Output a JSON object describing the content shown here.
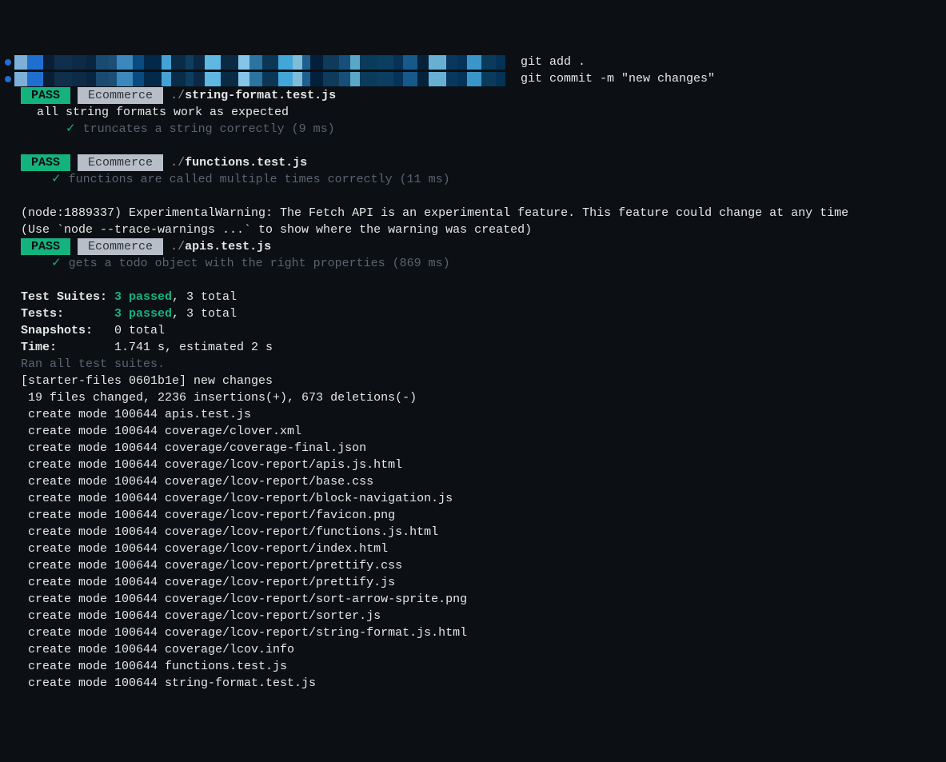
{
  "prompts": [
    {
      "cmd": "git add ."
    },
    {
      "cmd": "git commit -m \"new changes\""
    }
  ],
  "prompt_bar_colors": [
    "#7db0d8",
    "#1f6fd0",
    "#0a1f33",
    "#0f2f4d",
    "#0d2a46",
    "#0a2540",
    "#1a4a70",
    "#1c4f78",
    "#3a88bc",
    "#094b80",
    "#03294a",
    "#44a2d6",
    "#0a2c47",
    "#0e3e5f",
    "#0b2945",
    "#5fb8e2",
    "#0a2a44",
    "#86c4e8",
    "#2b73a0",
    "#0b3656",
    "#42a6d9",
    "#7fbcd8",
    "#1d608e",
    "#02203c",
    "#0f3a5a",
    "#164f7a",
    "#5aa7c9",
    "#0a3b5a",
    "#0b3e60",
    "#063255",
    "#16598a",
    "#05223a",
    "#67b0d4",
    "#09385e",
    "#033357",
    "#3a96c8",
    "#0a3b5a",
    "#033357"
  ],
  "prompt_bar_widths": [
    16,
    20,
    14,
    22,
    18,
    12,
    16,
    10,
    20,
    14,
    22,
    12,
    18,
    10,
    14,
    20,
    22,
    14,
    16,
    20,
    18,
    12,
    10,
    16,
    20,
    14,
    12,
    22,
    20,
    12,
    18,
    14,
    22,
    14,
    12,
    18,
    18,
    12
  ],
  "test_blocks": [
    {
      "status": "PASS",
      "tag": "Ecommerce",
      "path_prefix": "./",
      "file": "string-format.test.js",
      "describe": "all string formats work as expected",
      "tests": [
        {
          "name": "truncates a string correctly",
          "time": "(9 ms)"
        }
      ]
    },
    {
      "status": "PASS",
      "tag": "Ecommerce",
      "path_prefix": "./",
      "file": "functions.test.js",
      "describe": null,
      "tests": [
        {
          "name": "functions are called multiple times correctly",
          "time": "(11 ms)"
        }
      ]
    }
  ],
  "warning_lines": [
    "(node:1889337) ExperimentalWarning: The Fetch API is an experimental feature. This feature could change at any time",
    "(Use `node --trace-warnings ...` to show where the warning was created)"
  ],
  "test_block_after_warning": {
    "status": "PASS",
    "tag": "Ecommerce",
    "path_prefix": "./",
    "file": "apis.test.js",
    "describe": null,
    "tests": [
      {
        "name": "gets a todo object with the right properties",
        "time": "(869 ms)"
      }
    ]
  },
  "summary": {
    "suites_label": "Test Suites:",
    "suites_passed": "3 passed",
    "suites_total": ", 3 total",
    "tests_label": "Tests:",
    "tests_passed": "3 passed",
    "tests_total": ", 3 total",
    "snapshots_label": "Snapshots:",
    "snapshots_value": "0 total",
    "time_label": "Time:",
    "time_value": "1.741 s, estimated 2 s",
    "ran_all": "Ran all test suites."
  },
  "commit": {
    "header": "[starter-files 0601b1e] new changes",
    "stats": " 19 files changed, 2236 insertions(+), 673 deletions(-)",
    "created": [
      " create mode 100644 apis.test.js",
      " create mode 100644 coverage/clover.xml",
      " create mode 100644 coverage/coverage-final.json",
      " create mode 100644 coverage/lcov-report/apis.js.html",
      " create mode 100644 coverage/lcov-report/base.css",
      " create mode 100644 coverage/lcov-report/block-navigation.js",
      " create mode 100644 coverage/lcov-report/favicon.png",
      " create mode 100644 coverage/lcov-report/functions.js.html",
      " create mode 100644 coverage/lcov-report/index.html",
      " create mode 100644 coverage/lcov-report/prettify.css",
      " create mode 100644 coverage/lcov-report/prettify.js",
      " create mode 100644 coverage/lcov-report/sort-arrow-sprite.png",
      " create mode 100644 coverage/lcov-report/sorter.js",
      " create mode 100644 coverage/lcov-report/string-format.js.html",
      " create mode 100644 coverage/lcov.info",
      " create mode 100644 functions.test.js",
      " create mode 100644 string-format.test.js"
    ]
  },
  "check_glyph": "✓"
}
